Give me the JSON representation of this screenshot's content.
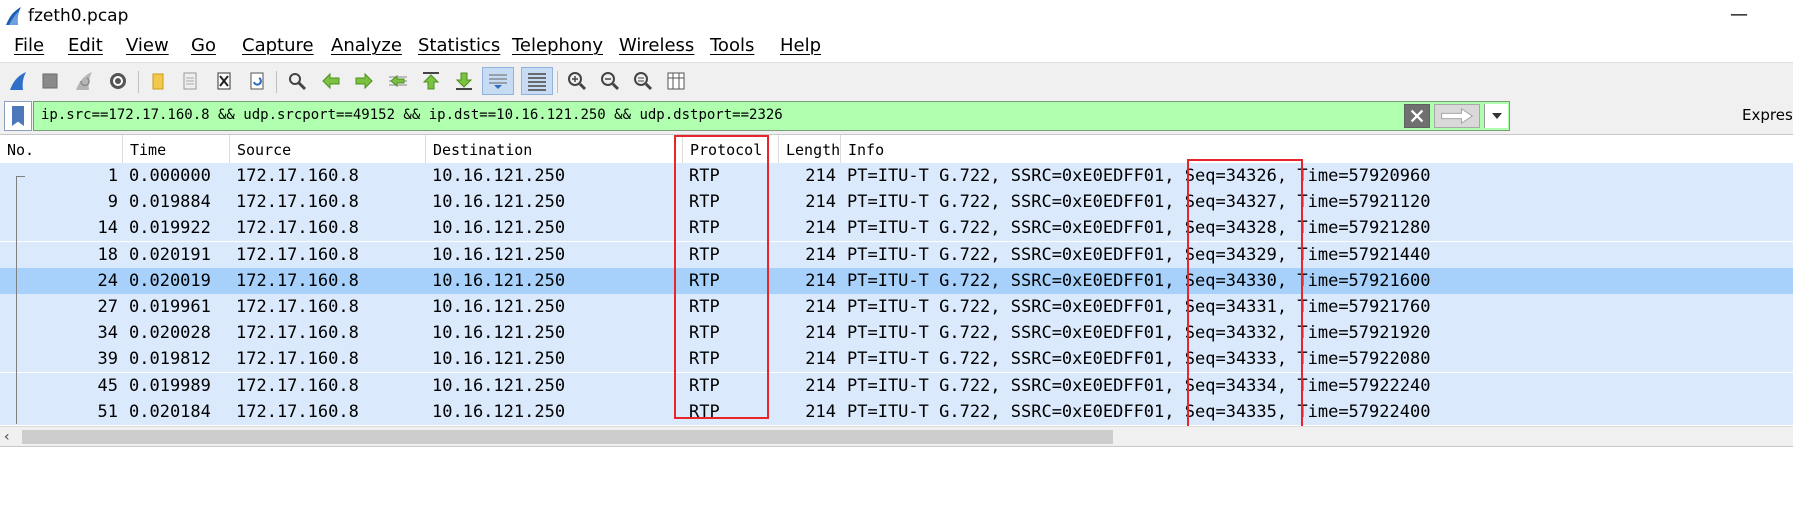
{
  "window": {
    "title": "fzeth0.pcap",
    "minimize_glyph": "—"
  },
  "menu": [
    "File",
    "Edit",
    "View",
    "Go",
    "Capture",
    "Analyze",
    "Statistics",
    "Telephony",
    "Wireless",
    "Tools",
    "Help"
  ],
  "filter": {
    "expression": "ip.src==172.17.160.8 && udp.srcport==49152 && ip.dst==10.16.121.250 && udp.dstport==2326",
    "background": "#afffaf",
    "expression_button": "Expres"
  },
  "columns": [
    "No.",
    "Time",
    "Source",
    "Destination",
    "Protocol",
    "Length",
    "Info"
  ],
  "packets": [
    {
      "no": "1",
      "time": "0.000000",
      "src": "172.17.160.8",
      "dst": "10.16.121.250",
      "proto": "RTP",
      "len": "214",
      "info_a": "PT=ITU-T G.722, SSRC=0xE0EDFF01,",
      "seq": "Seq=34326,",
      "ts": "Time=57920960"
    },
    {
      "no": "9",
      "time": "0.019884",
      "src": "172.17.160.8",
      "dst": "10.16.121.250",
      "proto": "RTP",
      "len": "214",
      "info_a": "PT=ITU-T G.722, SSRC=0xE0EDFF01,",
      "seq": "Seq=34327,",
      "ts": "Time=57921120"
    },
    {
      "no": "14",
      "time": "0.019922",
      "src": "172.17.160.8",
      "dst": "10.16.121.250",
      "proto": "RTP",
      "len": "214",
      "info_a": "PT=ITU-T G.722, SSRC=0xE0EDFF01,",
      "seq": "Seq=34328,",
      "ts": "Time=57921280"
    },
    {
      "no": "18",
      "time": "0.020191",
      "src": "172.17.160.8",
      "dst": "10.16.121.250",
      "proto": "RTP",
      "len": "214",
      "info_a": "PT=ITU-T G.722, SSRC=0xE0EDFF01,",
      "seq": "Seq=34329,",
      "ts": "Time=57921440"
    },
    {
      "no": "24",
      "time": "0.020019",
      "src": "172.17.160.8",
      "dst": "10.16.121.250",
      "proto": "RTP",
      "len": "214",
      "info_a": "PT=ITU-T G.722, SSRC=0xE0EDFF01,",
      "seq": "Seq=34330,",
      "ts": "Time=57921600"
    },
    {
      "no": "27",
      "time": "0.019961",
      "src": "172.17.160.8",
      "dst": "10.16.121.250",
      "proto": "RTP",
      "len": "214",
      "info_a": "PT=ITU-T G.722, SSRC=0xE0EDFF01,",
      "seq": "Seq=34331,",
      "ts": "Time=57921760"
    },
    {
      "no": "34",
      "time": "0.020028",
      "src": "172.17.160.8",
      "dst": "10.16.121.250",
      "proto": "RTP",
      "len": "214",
      "info_a": "PT=ITU-T G.722, SSRC=0xE0EDFF01,",
      "seq": "Seq=34332,",
      "ts": "Time=57921920"
    },
    {
      "no": "39",
      "time": "0.019812",
      "src": "172.17.160.8",
      "dst": "10.16.121.250",
      "proto": "RTP",
      "len": "214",
      "info_a": "PT=ITU-T G.722, SSRC=0xE0EDFF01,",
      "seq": "Seq=34333,",
      "ts": "Time=57922080"
    },
    {
      "no": "45",
      "time": "0.019989",
      "src": "172.17.160.8",
      "dst": "10.16.121.250",
      "proto": "RTP",
      "len": "214",
      "info_a": "PT=ITU-T G.722, SSRC=0xE0EDFF01,",
      "seq": "Seq=34334,",
      "ts": "Time=57922240"
    },
    {
      "no": "51",
      "time": "0.020184",
      "src": "172.17.160.8",
      "dst": "10.16.121.250",
      "proto": "RTP",
      "len": "214",
      "info_a": "PT=ITU-T G.722, SSRC=0xE0EDFF01,",
      "seq": "Seq=34335,",
      "ts": "Time=57922400"
    }
  ],
  "selected_packet_no": "24",
  "colors": {
    "row": "#dbe9fc",
    "selected_row": "#a7d0fa",
    "highlight_box": "#e8262a"
  },
  "toolbar_icons": [
    "shark-fin-start-icon",
    "stop-icon",
    "restart-icon",
    "options-gear-icon",
    "open-folder-icon",
    "save-file-icon",
    "close-file-icon",
    "reload-icon",
    "find-icon",
    "go-back-icon",
    "go-forward-icon",
    "go-to-packet-icon",
    "first-packet-icon",
    "last-packet-icon",
    "autoscroll-icon",
    "colorize-icon",
    "zoom-in-icon",
    "zoom-out-icon",
    "normal-size-icon",
    "resize-columns-icon"
  ]
}
